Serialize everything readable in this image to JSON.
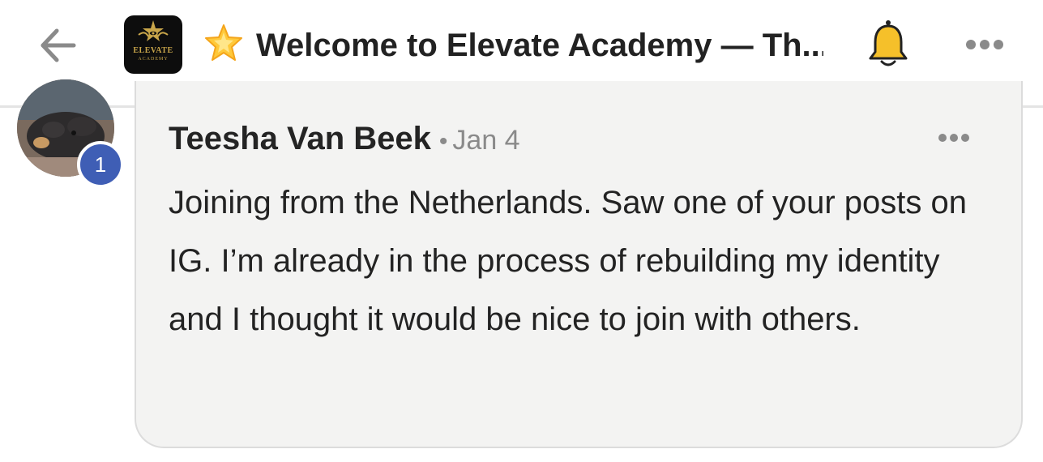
{
  "header": {
    "title": "Welcome to Elevate Academy — Th...",
    "logo": {
      "line1": "ELEVATE",
      "line2": "ACADEMY"
    },
    "icons": {
      "back": "arrow-left-icon",
      "title_emoji": "glowing-star-icon",
      "notifications": "bell-icon",
      "more": "more-horizontal-icon"
    },
    "colors": {
      "bell": "#f5c02a",
      "logo_bg": "#0d0d0d",
      "logo_gold": "#c9a64a"
    }
  },
  "comment": {
    "author": "Teesha Van Beek",
    "separator": "•",
    "date": "Jan 4",
    "avatar_badge": "1",
    "body": "Joining from the Netherlands. Saw one of your posts on IG. I’m already in the process of rebuilding my identity and I thought it would be nice to join with others.",
    "colors": {
      "badge": "#3f5eb5",
      "card_bg": "#f3f3f2"
    }
  }
}
